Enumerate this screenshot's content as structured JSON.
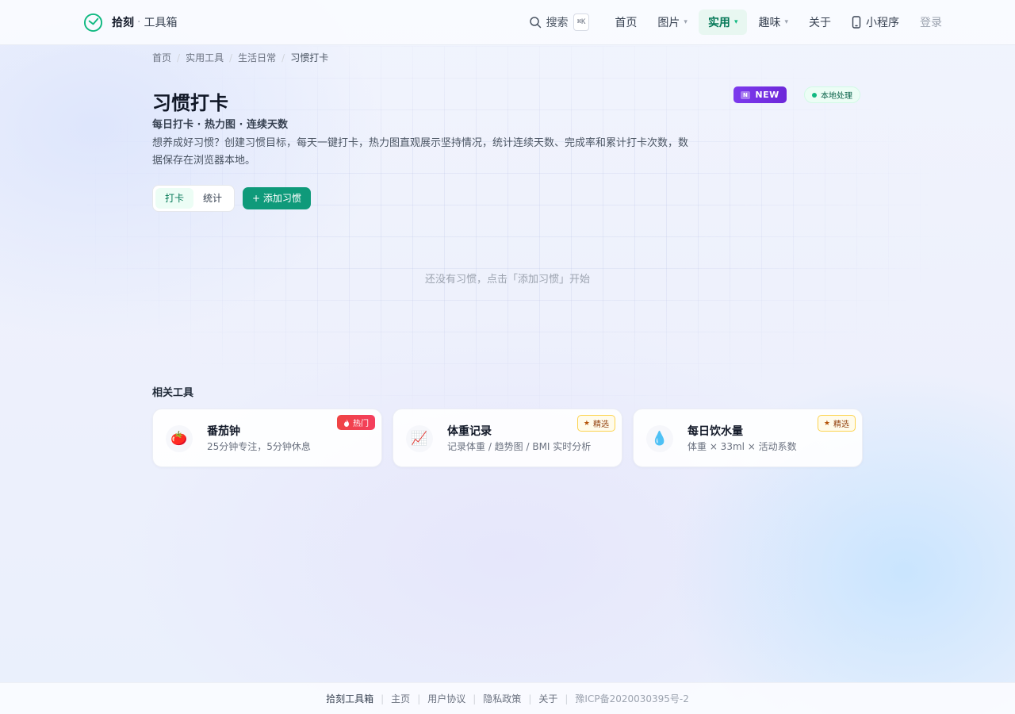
{
  "header": {
    "brand_name": "拾刻",
    "brand_separator": "·",
    "brand_sub": "工具箱",
    "search_label": "搜索",
    "search_shortcut": "⌘K",
    "nav": {
      "home": "首页",
      "images": "图片",
      "utility": "实用",
      "fun": "趣味",
      "about": "关于",
      "mini_program": "小程序"
    },
    "login": "登录",
    "active_nav": "实用"
  },
  "breadcrumb": {
    "items": [
      "首页",
      "实用工具",
      "生活日常",
      "习惯打卡"
    ],
    "separator": "/"
  },
  "page": {
    "title": "习惯打卡",
    "subtitle": "每日打卡 · 热力图 · 连续天数",
    "description": "想养成好习惯？创建习惯目标，每天一键打卡，热力图直观展示坚持情况，统计连续天数、完成率和累计打卡次数，数据保存在浏览器本地。",
    "badge_new": "NEW",
    "badge_new_glyph": "N",
    "badge_local": "本地处理"
  },
  "tabs": {
    "checkin": "打卡",
    "stats": "统计",
    "active": "打卡"
  },
  "actions": {
    "add_habit": "+ 添加习惯"
  },
  "empty_state": "还没有习惯，点击「添加习惯」开始",
  "related": {
    "title": "相关工具",
    "cards": [
      {
        "icon": "🍅",
        "icon_name": "tomato-icon",
        "name": "番茄钟",
        "desc": "25分钟专注，5分钟休息",
        "tag": "热门",
        "tag_type": "hot"
      },
      {
        "icon": "📈",
        "icon_name": "chart-up-icon",
        "name": "体重记录",
        "desc": "记录体重 / 趋势图 / BMI 实时分析",
        "tag": "精选",
        "tag_type": "pick"
      },
      {
        "icon": "💧",
        "icon_name": "droplet-icon",
        "name": "每日饮水量",
        "desc": "体重 × 33ml × 活动系数",
        "tag": "精选",
        "tag_type": "pick"
      }
    ]
  },
  "footer": {
    "brand": "拾刻工具箱",
    "links": [
      "主页",
      "用户协议",
      "隐私政策",
      "关于"
    ],
    "icp": "豫ICP备2020030395号-2",
    "separator": "|"
  },
  "colors": {
    "accent": "#0f9a7a",
    "accent_light": "#ecfdf5",
    "new_badge": "#7c3aed",
    "hot_tag": "#ef4444",
    "pick_tag_border": "#fcd34d"
  }
}
